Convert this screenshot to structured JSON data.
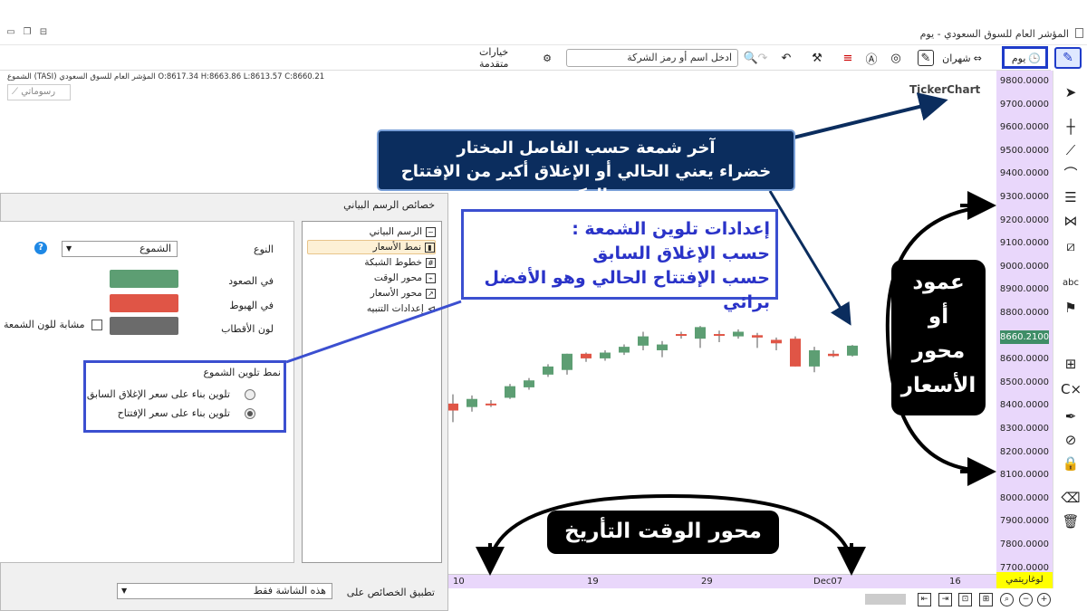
{
  "window": {
    "title": "المؤشر العام للسوق السعودي - يوم",
    "controls": [
      "▭",
      "❐",
      "⊟"
    ]
  },
  "toolbar": {
    "period_label": "يوم",
    "period_icon": "clock-icon",
    "monthly_label": "شهران",
    "search_placeholder": "ادخل اسم أو رمز الشركة",
    "advanced_label": "خيارات متقدمة"
  },
  "chart": {
    "ohlc_text": "الشموع (TASI) المؤشر العام للسوق السعودي O:8617.34 H:8663.86 L:8613.57 C:8660.21",
    "draw_label": "رسوماتي",
    "brand": "TickerChart",
    "current_price": "8660.2100",
    "log_label": "لوغاريتمي",
    "price_ticks": [
      "9800.0000",
      "9700.0000",
      "9600.0000",
      "9500.0000",
      "9400.0000",
      "9300.0000",
      "9200.0000",
      "9100.0000",
      "9000.0000",
      "8900.0000",
      "8800.0000",
      "8700.0000",
      "8600.0000",
      "8500.0000",
      "8400.0000",
      "8300.0000",
      "8200.0000",
      "8100.0000",
      "8000.0000",
      "7900.0000",
      "7800.0000",
      "7700.0000"
    ],
    "time_ticks": [
      "10",
      "19",
      "29",
      "Dec07",
      "16"
    ],
    "up_color": "#5d9e73",
    "down_color": "#e05546"
  },
  "chart_data": {
    "type": "candlestick",
    "ylim": [
      7700,
      9800
    ],
    "candles": [
      {
        "o": 8410,
        "h": 8450,
        "l": 8330,
        "c": 8380,
        "dir": "down"
      },
      {
        "o": 8395,
        "h": 8445,
        "l": 8375,
        "c": 8430,
        "dir": "up"
      },
      {
        "o": 8410,
        "h": 8425,
        "l": 8395,
        "c": 8405,
        "dir": "down"
      },
      {
        "o": 8435,
        "h": 8495,
        "l": 8430,
        "c": 8485,
        "dir": "up"
      },
      {
        "o": 8480,
        "h": 8520,
        "l": 8470,
        "c": 8510,
        "dir": "up"
      },
      {
        "o": 8535,
        "h": 8580,
        "l": 8525,
        "c": 8570,
        "dir": "up"
      },
      {
        "o": 8555,
        "h": 8625,
        "l": 8535,
        "c": 8625,
        "dir": "up"
      },
      {
        "o": 8625,
        "h": 8630,
        "l": 8590,
        "c": 8605,
        "dir": "down"
      },
      {
        "o": 8605,
        "h": 8640,
        "l": 8595,
        "c": 8630,
        "dir": "up"
      },
      {
        "o": 8630,
        "h": 8665,
        "l": 8620,
        "c": 8655,
        "dir": "up"
      },
      {
        "o": 8660,
        "h": 8720,
        "l": 8640,
        "c": 8700,
        "dir": "up"
      },
      {
        "o": 8640,
        "h": 8680,
        "l": 8610,
        "c": 8665,
        "dir": "up"
      },
      {
        "o": 8710,
        "h": 8720,
        "l": 8690,
        "c": 8705,
        "dir": "down"
      },
      {
        "o": 8690,
        "h": 8745,
        "l": 8650,
        "c": 8740,
        "dir": "up"
      },
      {
        "o": 8710,
        "h": 8725,
        "l": 8675,
        "c": 8710,
        "dir": "down"
      },
      {
        "o": 8700,
        "h": 8730,
        "l": 8690,
        "c": 8720,
        "dir": "up"
      },
      {
        "o": 8705,
        "h": 8715,
        "l": 8650,
        "c": 8695,
        "dir": "down"
      },
      {
        "o": 8685,
        "h": 8695,
        "l": 8640,
        "c": 8670,
        "dir": "down"
      },
      {
        "o": 8690,
        "h": 8700,
        "l": 8570,
        "c": 8570,
        "dir": "down"
      },
      {
        "o": 8570,
        "h": 8655,
        "l": 8545,
        "c": 8640,
        "dir": "up"
      },
      {
        "o": 8625,
        "h": 8640,
        "l": 8610,
        "c": 8615,
        "dir": "down"
      },
      {
        "o": 8617,
        "h": 8663,
        "l": 8613,
        "c": 8660,
        "dir": "up"
      }
    ]
  },
  "dialog": {
    "title": "خصائص الرسم البياني",
    "tree": [
      {
        "label": "الرسم البياني",
        "icon": "chart-icon"
      },
      {
        "label": "نمط الأسعار",
        "icon": "candles-icon"
      },
      {
        "label": "خطوط الشبكة",
        "icon": "grid-icon"
      },
      {
        "label": "محور الوقت",
        "icon": "time-axis-icon"
      },
      {
        "label": "محور الأسعار",
        "icon": "price-axis-icon"
      },
      {
        "label": "إعدادات التنبيه",
        "icon": "alert-icon"
      }
    ],
    "type_label": "النوع",
    "type_value": "الشموع",
    "up_label": "في الصعود",
    "down_label": "في الهبوط",
    "wick_label": "لون الأقطاب",
    "same_color_label": "مشابة للون الشمعة",
    "coloring_title": "نمط تلوين الشموع",
    "option_prev_close": "تلوين بناء على سعر الإغلاق السابق",
    "option_open": "تلوين بناء على سعر الإفتتاح",
    "apply_label": "تطبيق الخصائص على",
    "apply_value": "هذه الشاشة فقط",
    "colors": {
      "up": "#5d9e73",
      "down": "#e05546",
      "wick": "#6b6b6b"
    }
  },
  "annotations": {
    "last_candle_line1": "آخر شمعة حسب الفاصل المختار",
    "last_candle_line2": "خضراء يعني الحالي أو الإغلاق أكبر من الإفتتاح والعكس",
    "coloring_line1": "إعدادات تلوين الشمعة :",
    "coloring_line2": "حسب الإغلاق السابق",
    "coloring_line3": "حسب الإفتتاح الحالي وهو الأفضل برائي",
    "price_axis_line1": "عمود",
    "price_axis_line2": "أو",
    "price_axis_line3": "محور",
    "price_axis_line4": "الأسعار",
    "time_axis": "محور الوقت التأريخ"
  }
}
